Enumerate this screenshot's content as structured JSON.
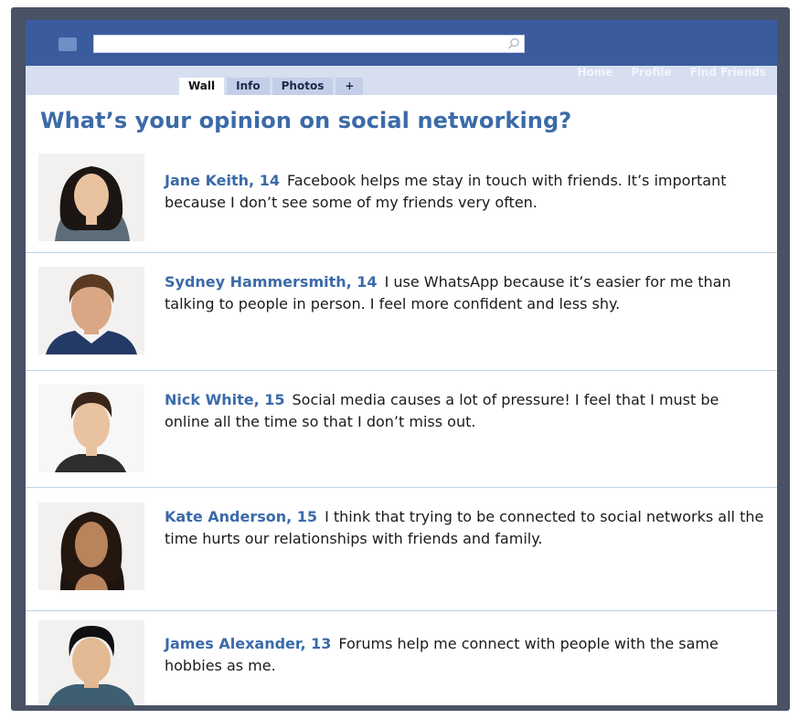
{
  "header": {
    "search": {
      "placeholder": ""
    },
    "tabs": [
      {
        "label": "Wall"
      },
      {
        "label": "Info"
      },
      {
        "label": "Photos"
      },
      {
        "label": "+"
      }
    ],
    "nav": [
      {
        "label": "Home"
      },
      {
        "label": "Profile"
      },
      {
        "label": "Find Friends"
      }
    ]
  },
  "main": {
    "title": "What’s your opinion on social networking?",
    "posts": [
      {
        "author": "Jane Keith, 14",
        "text": "Facebook helps me stay in touch with friends. It’s important because I don’t see some of my friends very often."
      },
      {
        "author": "Sydney Hammersmith, 14",
        "text": "I use WhatsApp because it’s easier for me than talking to people in person. I feel more confident and less shy."
      },
      {
        "author": "Nick White, 15",
        "text": "Social media causes a lot of pressure! I feel that I must be online all the time so that I don’t miss out."
      },
      {
        "author": "Kate Anderson, 15",
        "text": "I think that trying to be connected to social networks all the time hurts our relationships with friends and family."
      },
      {
        "author": "James Alexander, 13",
        "text": "Forums help me connect with people with the same hobbies as me."
      }
    ]
  },
  "colors": {
    "brand_blue": "#3a5c9e",
    "sub_bar": "#d6def0",
    "heading_blue": "#3b6aa8",
    "frame": "#4a5266"
  }
}
